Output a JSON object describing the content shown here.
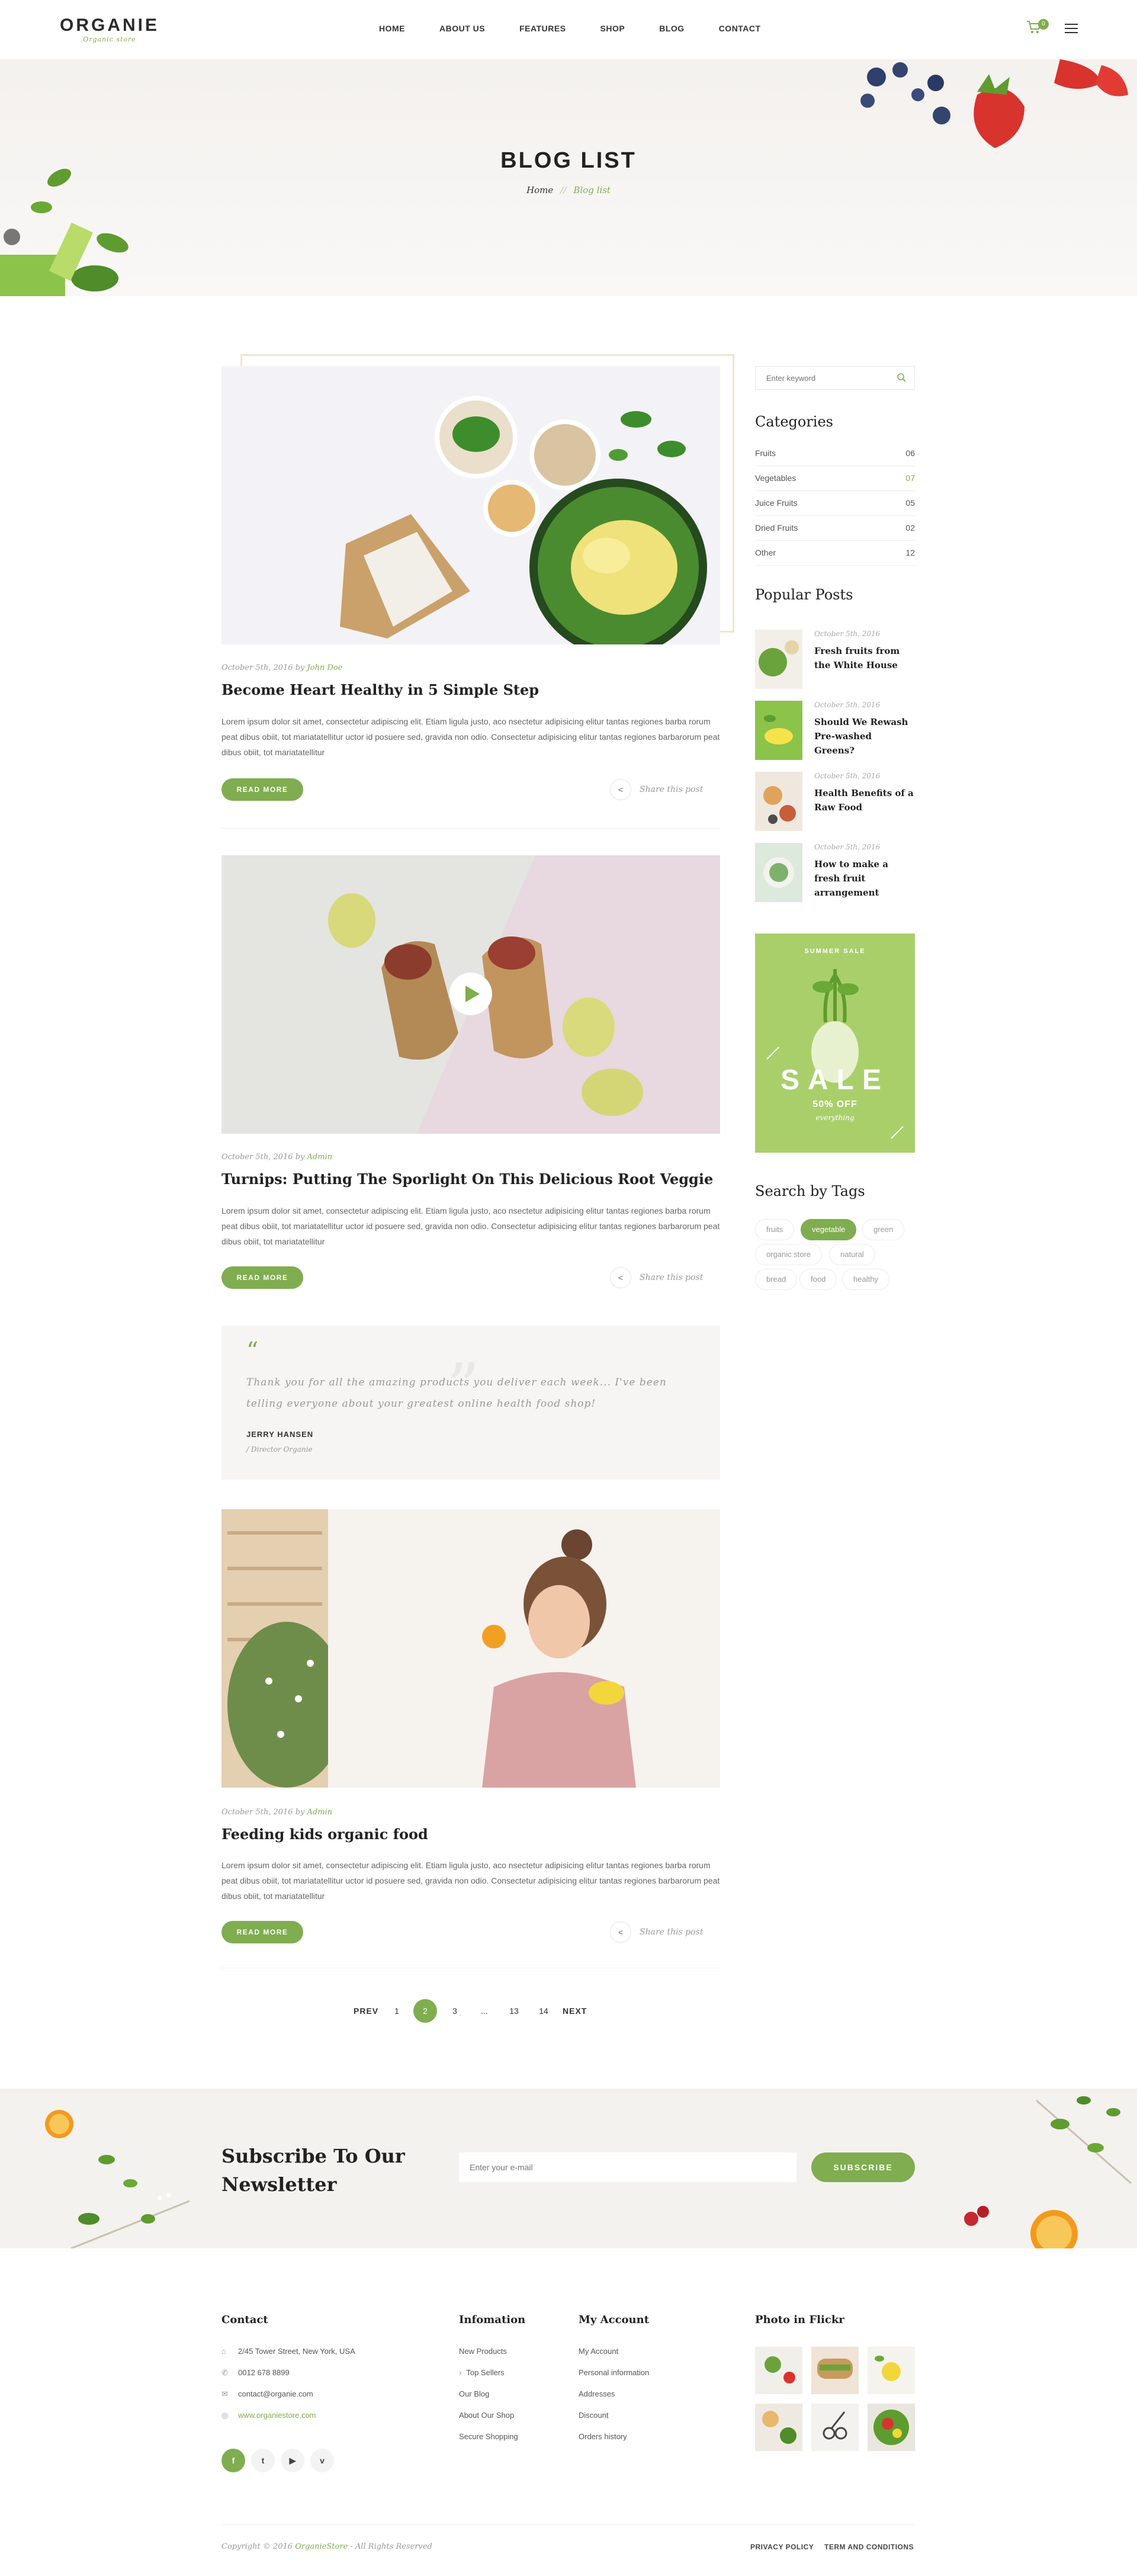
{
  "brand": {
    "name": "ORGANIE",
    "tagline": "Organic store"
  },
  "nav": [
    "HOME",
    "ABOUT US",
    "FEATURES",
    "SHOP",
    "BLOG",
    "CONTACT"
  ],
  "cart": {
    "count": "0"
  },
  "banner": {
    "title": "BLOG LIST",
    "breadcrumb": [
      "Home",
      "Blog list"
    ],
    "separator": "//"
  },
  "posts": [
    {
      "meta_date": "October 5th, 2016 by",
      "author": "John Doe",
      "title": "Become Heart Healthy in 5 Simple Step",
      "excerpt": "Lorem ipsum dolor sit amet, consectetur adipiscing elit. Etiam ligula justo, aco nsectetur adipisicing elitur tantas regiones barba rorum peat dibus obiit, tot mariatatellitur uctor id posuere sed, gravida non odio. Consectetur adipisicing elitur tantas regiones barbarorum peat dibus obiit, tot mariatatellitur",
      "read_more": "READ MORE",
      "share": "Share this post"
    },
    {
      "meta_date": "October 5th, 2016 by",
      "author": "Admin",
      "title": "Turnips: Putting The Sporlight On This Delicious Root Veggie",
      "excerpt": "Lorem ipsum dolor sit amet, consectetur adipiscing elit. Etiam ligula justo, aco nsectetur adipisicing elitur tantas regiones barba rorum peat dibus obiit, tot mariatatellitur uctor id posuere sed, gravida non odio. Consectetur adipisicing elitur tantas regiones barbarorum peat dibus obiit, tot mariatatellitur",
      "read_more": "READ MORE",
      "share": "Share this post"
    },
    {
      "meta_date": "October 5th, 2016 by",
      "author": "Admin",
      "title": "Feeding kids organic food",
      "excerpt": "Lorem ipsum dolor sit amet, consectetur adipiscing elit. Etiam ligula justo, aco nsectetur adipisicing elitur tantas regiones barba rorum peat dibus obiit, tot mariatatellitur uctor id posuere sed, gravida non odio. Consectetur adipisicing elitur tantas regiones barbarorum peat dibus obiit, tot mariatatellitur",
      "read_more": "READ MORE",
      "share": "Share this post"
    }
  ],
  "quote": {
    "text": "Thank you for all the amazing products you deliver each week... I've been telling everyone about your greatest online health food shop!",
    "name": "JERRY HANSEN",
    "role": "Director Organie"
  },
  "pagination": {
    "prev": "PREV",
    "next": "NEXT",
    "pages": [
      "1",
      "2",
      "3",
      "...",
      "13",
      "14"
    ],
    "active": "2"
  },
  "sidebar": {
    "search_placeholder": "Enter keyword",
    "categories_title": "Categories",
    "categories": [
      {
        "label": "Fruits",
        "count": "06"
      },
      {
        "label": "Vegetables",
        "count": "07"
      },
      {
        "label": "Juice Fruits",
        "count": "05"
      },
      {
        "label": "Dried Fruits",
        "count": "02"
      },
      {
        "label": "Other",
        "count": "12"
      }
    ],
    "popular_title": "Popular Posts",
    "popular": [
      {
        "date": "October 5th, 2016",
        "title": "Fresh fruits from the White House"
      },
      {
        "date": "October 5th, 2016",
        "title": "Should We Rewash Pre-washed Greens?"
      },
      {
        "date": "October 5th, 2016",
        "title": "Health Benefits of a Raw Food"
      },
      {
        "date": "October 5th, 2016",
        "title": "How to make a fresh fruit arrangement"
      }
    ],
    "sale": {
      "kicker": "SUMMER SALE",
      "title": "SALE",
      "discount": "50% OFF",
      "sub": "everything"
    },
    "tags_title": "Search by Tags",
    "tags": [
      "fruits",
      "vegetable",
      "green",
      "organic store",
      "natural",
      "bread",
      "food",
      "healthy"
    ],
    "active_tag": "vegetable"
  },
  "newsletter": {
    "title": "Subscribe To Our Newsletter",
    "placeholder": "Enter your e-mail",
    "button": "SUBSCRIBE"
  },
  "footer": {
    "contact_title": "Contact",
    "contact": [
      "2/45 Tower Street, New York, USA",
      "0012 678 8899",
      "contact@organie.com",
      "www.organiestore.com"
    ],
    "info_title": "Infomation",
    "info": [
      "New Products",
      "Top Sellers",
      "Our Blog",
      "About Our Shop",
      "Secure Shopping"
    ],
    "account_title": "My Account",
    "account": [
      "My Account",
      "Personal information",
      "Addresses",
      "Discount",
      "Orders history"
    ],
    "flickr_title": "Photo in Flickr",
    "social": [
      "f",
      "t",
      "▶",
      "v"
    ],
    "copyright_prefix": "Copyright © 2016",
    "copyright_brand": "OrganieStore",
    "copyright_suffix": "- All Rights Reserved",
    "legal": [
      "PRIVACY POLICY",
      "TERM AND CONDITIONS"
    ]
  },
  "colors": {
    "accent": "#7fad4f",
    "text": "#222222",
    "muted": "#999999"
  }
}
